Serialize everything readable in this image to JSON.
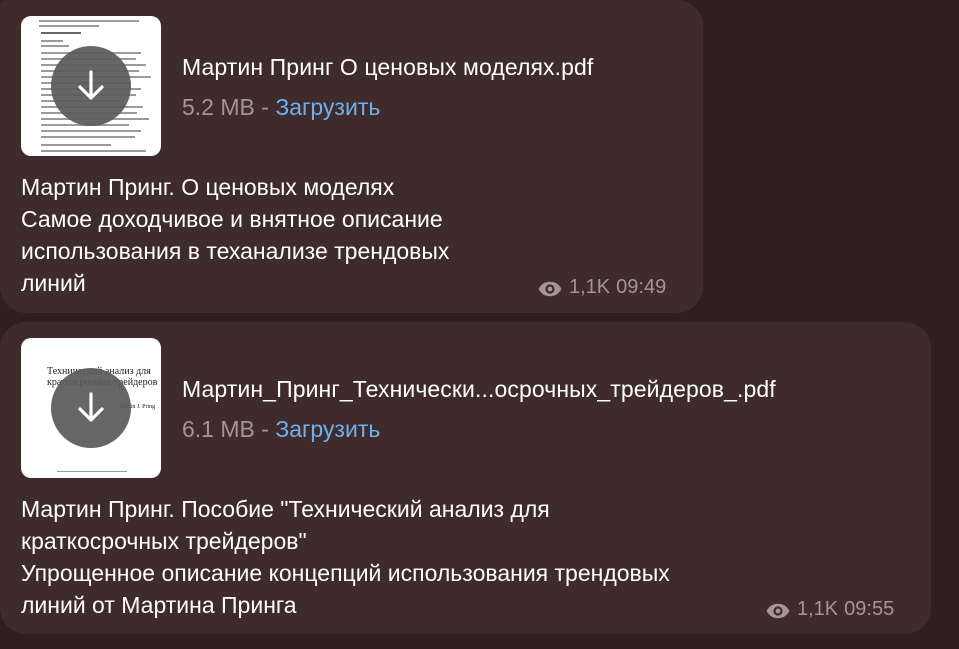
{
  "messages": [
    {
      "file_name": "Мартин Принг О ценовых моделях.pdf",
      "file_size": "5.2 MB",
      "separator": "-",
      "download_label": "Загрузить",
      "caption_lines": [
        "Мартин Принг. О ценовых моделях",
        "Самое доходчивое и внятное описание",
        "использования в теханализе трендовых",
        "линий"
      ],
      "views": "1,1K",
      "time": "09:49"
    },
    {
      "file_name": "Мартин_Принг_Технически...осрочных_трейдеров_.pdf",
      "file_size": "6.1 MB",
      "separator": "-",
      "download_label": "Загрузить",
      "thumb_text": {
        "title_line1": "Технический анализ для",
        "title_line2": "краткосрочных трейдеров",
        "author": "Martin J. Pring"
      },
      "caption_lines": [
        "Мартин Принг. Пособие \"Технический анализ для",
        "краткосрочных трейдеров\"",
        "Упрощенное описание концепций использования трендовых",
        "линий от Мартина Принга"
      ],
      "views": "1,1K",
      "time": "09:55"
    }
  ],
  "icons": {
    "download": "download-arrow-icon",
    "views": "eye-icon"
  },
  "colors": {
    "background": "#2f1f21",
    "bubble": "#3f2a2c",
    "link": "#6cb2ee",
    "muted": "#a69496"
  }
}
